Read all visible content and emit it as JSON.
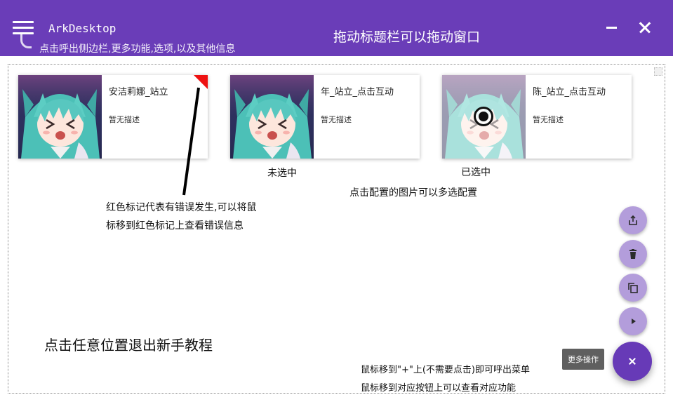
{
  "titlebar": {
    "app_title": "ArkDesktop",
    "menu_hint": "点击呼出侧边栏,更多功能,选项,以及其他信息",
    "drag_hint": "拖动标题栏可以拖动窗口",
    "menu_icon": "hamburger-menu-icon",
    "minimize_icon": "minimize-icon",
    "close_icon": "close-icon"
  },
  "cards": [
    {
      "name": "安洁莉娜_站立",
      "desc": "暂无描述",
      "state": "error"
    },
    {
      "name": "年_站立_点击互动",
      "desc": "暂无描述",
      "state": "unselected"
    },
    {
      "name": "陈_站立_点击互动",
      "desc": "暂无描述",
      "state": "selected"
    }
  ],
  "annotations": {
    "unselected": "未选中",
    "selected": "已选中",
    "multi_select": "点击配置的图片可以多选配置",
    "error_line1": "红色标记代表有错误发生,可以将鼠",
    "error_line2": "标移到红色标记上查看错误信息",
    "exit_tutorial": "点击任意位置退出新手教程",
    "fab_hint_line1": "鼠标移到\"+\"上(不需要点击)即可呼出菜单",
    "fab_hint_line2": "鼠标移到对应按钮上可以查看对应功能"
  },
  "fab": {
    "tooltip": "更多操作",
    "actions": [
      "share-icon",
      "delete-icon",
      "copy-icon",
      "play-icon"
    ],
    "main_icon": "close-icon"
  },
  "colors": {
    "titlebar": "#6a3db8",
    "fab_main": "#673ab7",
    "fab_small": "#b39ddb",
    "error_mark": "#ee1111"
  }
}
